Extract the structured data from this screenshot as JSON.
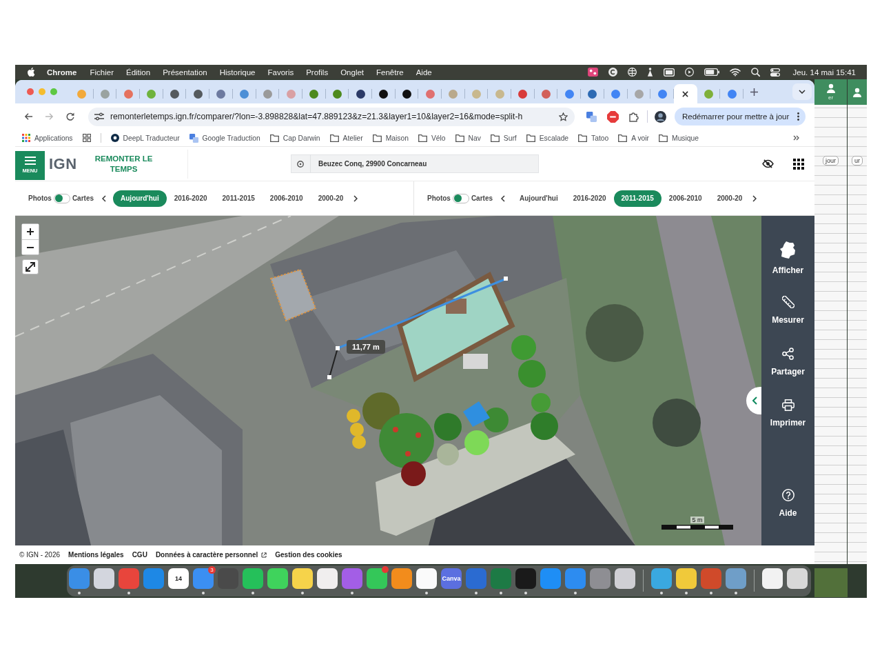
{
  "menu_bar": {
    "app": "Chrome",
    "menus": [
      "Fichier",
      "Édition",
      "Présentation",
      "Historique",
      "Favoris",
      "Profils",
      "Onglet",
      "Fenêtre",
      "Aide"
    ],
    "clock": "Jeu. 14 mai 15:41"
  },
  "browser": {
    "tabs": [
      {
        "selected": false,
        "color": "#f2a93b"
      },
      {
        "selected": false,
        "color": "#9aa3a0"
      },
      {
        "selected": false,
        "color": "#e5725f"
      },
      {
        "selected": false,
        "color": "#6fb33d"
      },
      {
        "selected": false,
        "color": "#555a5e"
      },
      {
        "selected": false,
        "color": "#555a5e"
      },
      {
        "selected": false,
        "color": "#6d7aa0"
      },
      {
        "selected": false,
        "color": "#4d8fd6"
      },
      {
        "selected": false,
        "color": "#9a9a9a"
      },
      {
        "selected": false,
        "color": "#d9a0a4"
      },
      {
        "selected": false,
        "color": "#4d8a1e"
      },
      {
        "selected": false,
        "color": "#4d8a1e"
      },
      {
        "selected": false,
        "color": "#2b3a67"
      },
      {
        "selected": false,
        "color": "#111111"
      },
      {
        "selected": false,
        "color": "#111111"
      },
      {
        "selected": false,
        "color": "#e07070"
      },
      {
        "selected": false,
        "color": "#b9a98c"
      },
      {
        "selected": false,
        "color": "#c8b88e"
      },
      {
        "selected": false,
        "color": "#c8b88e"
      },
      {
        "selected": false,
        "color": "#d83b3b"
      },
      {
        "selected": false,
        "color": "#d2605a"
      },
      {
        "selected": false,
        "color": "#4285f4"
      },
      {
        "selected": false,
        "color": "#2d6ab3"
      },
      {
        "selected": false,
        "color": "#4285f4"
      },
      {
        "selected": false,
        "color": "#a7a7a7"
      },
      {
        "selected": false,
        "color": "#4285f4"
      },
      {
        "selected": true
      },
      {
        "selected": false,
        "color": "#7fb03a"
      },
      {
        "selected": false,
        "color": "#4285f4"
      }
    ],
    "url": "remonterletemps.ign.fr/comparer/?lon=-3.898828&lat=47.889123&z=21.3&layer1=10&layer2=16&mode=split-h",
    "update_button": "Redémarrer pour mettre à jour",
    "bookmarks": [
      {
        "kind": "apps",
        "label": "Applications"
      },
      {
        "kind": "grid"
      },
      {
        "kind": "site",
        "label": "DeepL Traducteur"
      },
      {
        "kind": "translate",
        "label": "Google Traduction"
      },
      {
        "kind": "folder",
        "label": "Cap Darwin"
      },
      {
        "kind": "folder",
        "label": "Atelier"
      },
      {
        "kind": "folder",
        "label": "Maison"
      },
      {
        "kind": "folder",
        "label": "Vélo"
      },
      {
        "kind": "folder",
        "label": "Nav"
      },
      {
        "kind": "folder",
        "label": "Surf"
      },
      {
        "kind": "folder",
        "label": "Escalade"
      },
      {
        "kind": "folder",
        "label": "Tatoo"
      },
      {
        "kind": "folder",
        "label": "A voir"
      },
      {
        "kind": "folder",
        "label": "Musique"
      }
    ]
  },
  "page": {
    "header": {
      "menu_label": "MENU",
      "logo": "IGN",
      "title": "REMONTER LE TEMPS",
      "search": {
        "value": "Beuzec Conq, 29900 Concarneau"
      }
    },
    "panes": [
      {
        "toggle": {
          "left": "Photos",
          "right": "Cartes",
          "on": false
        },
        "years": [
          {
            "label": "Aujourd'hui",
            "selected": true
          },
          {
            "label": "2016-2020",
            "selected": false
          },
          {
            "label": "2011-2015",
            "selected": false
          },
          {
            "label": "2006-2010",
            "selected": false
          },
          {
            "label": "2000-20",
            "selected": false
          }
        ]
      },
      {
        "toggle": {
          "left": "Photos",
          "right": "Cartes",
          "on": false
        },
        "years": [
          {
            "label": "Aujourd'hui",
            "selected": false
          },
          {
            "label": "2016-2020",
            "selected": false
          },
          {
            "label": "2011-2015",
            "selected": true
          },
          {
            "label": "2006-2010",
            "selected": false
          },
          {
            "label": "2000-20",
            "selected": false
          }
        ]
      }
    ],
    "map": {
      "measure": "11,77 m",
      "scale": "5 m"
    },
    "sidebar": [
      {
        "kind": "map",
        "label": "Afficher"
      },
      {
        "kind": "measure",
        "label": "Mesurer"
      },
      {
        "kind": "share",
        "label": "Partager"
      },
      {
        "kind": "print",
        "label": "Imprimer"
      },
      {
        "kind": "help",
        "label": "Aide"
      }
    ],
    "footer": [
      {
        "kind": "text",
        "label": "© IGN - 2026"
      },
      {
        "kind": "link",
        "label": "Mentions légales"
      },
      {
        "kind": "link",
        "label": "CGU"
      },
      {
        "kind": "external",
        "label": "Données à caractère personnel"
      },
      {
        "kind": "link",
        "label": "Gestion des cookies"
      }
    ]
  },
  "background_windows": [
    {
      "title": "er",
      "button": "jour"
    },
    {
      "button": "ur"
    }
  ],
  "dock": [
    {
      "kind": "app",
      "color": "#3a8ee6",
      "running": true
    },
    {
      "kind": "app",
      "color": "#d3d6de",
      "running": false
    },
    {
      "kind": "app",
      "color": "#e8453c",
      "running": true
    },
    {
      "kind": "app",
      "color": "#1e88e5",
      "running": false
    },
    {
      "kind": "app",
      "color": "#ffffff",
      "label": "14",
      "running": false
    },
    {
      "kind": "app",
      "color": "#3b8ff2",
      "badge": "3",
      "running": true
    },
    {
      "kind": "app",
      "color": "#4a4a4a",
      "running": false
    },
    {
      "kind": "app",
      "color": "#25c05a",
      "running": true
    },
    {
      "kind": "app",
      "color": "#3fd35c",
      "running": false
    },
    {
      "kind": "app",
      "color": "#f6d34a",
      "running": true
    },
    {
      "kind": "app",
      "color": "#f0eeee",
      "running": false
    },
    {
      "kind": "app",
      "color": "#a35ee6",
      "running": true
    },
    {
      "kind": "app",
      "color": "#34c759",
      "notified": true,
      "running": false
    },
    {
      "kind": "app",
      "color": "#f28c1c",
      "running": false
    },
    {
      "kind": "app",
      "color": "#fafafa",
      "running": true
    },
    {
      "kind": "app",
      "color": "#5b6fe0",
      "label": "Canva",
      "running": false
    },
    {
      "kind": "app",
      "color": "#2b6bd1",
      "running": true
    },
    {
      "kind": "app",
      "color": "#1d7a45",
      "running": true
    },
    {
      "kind": "app",
      "color": "#1a1a1a",
      "running": true
    },
    {
      "kind": "app",
      "color": "#1e8ef5",
      "running": false
    },
    {
      "kind": "app",
      "color": "#2d8cf0",
      "running": true
    },
    {
      "kind": "app",
      "color": "#8e8e93",
      "running": false
    },
    {
      "kind": "app",
      "color": "#cfcfd4",
      "running": false
    },
    {
      "kind": "separator"
    },
    {
      "kind": "app",
      "color": "#3aa8e0",
      "running": true
    },
    {
      "kind": "app",
      "color": "#f0c93a",
      "running": true
    },
    {
      "kind": "app",
      "color": "#d04a2a",
      "running": true
    },
    {
      "kind": "app",
      "color": "#6f9ec8",
      "running": true
    },
    {
      "kind": "separator"
    },
    {
      "kind": "app",
      "color": "#f2f2f2",
      "running": false
    },
    {
      "kind": "app",
      "color": "#d8d8d8",
      "running": false
    }
  ]
}
